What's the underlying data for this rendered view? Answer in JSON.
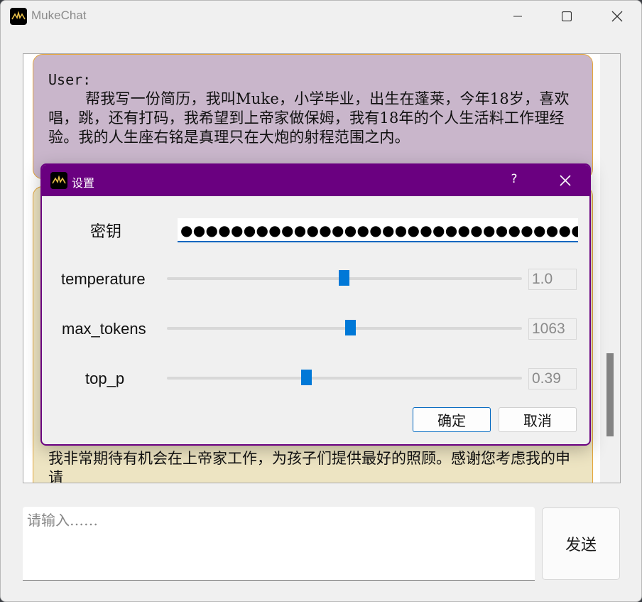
{
  "window": {
    "title": "MukeChat",
    "accent": "#6a0080"
  },
  "chat": {
    "user": {
      "speaker": "User:",
      "text": "帮我写一份简历，我叫Muke，小学毕业，出生在蓬莱，今年18岁，喜欢唱，跳，还有打码，我希望到上帝家做保姆，我有18年的个人生活料工作理经验。我的人生座右铭是真理只在大炮的射程范围之内。"
    },
    "assistant": {
      "visible_text": "我非常期待有机会在上帝家工作，为孩子们提供最好的照顾。感谢您考虑我的申请"
    }
  },
  "input": {
    "placeholder": "请输入……",
    "send_label": "发送"
  },
  "settings_dialog": {
    "title": "设置",
    "help": "?",
    "fields": {
      "api_key": {
        "label": "密钥",
        "masked_value": "●●●●●●●●●●●●●●●●●●●●●●●●●●●●●●●●●●●●●●●●●●●●●●●●●●●●●●●●●●"
      },
      "temperature": {
        "label": "temperature",
        "value": "1.0"
      },
      "max_tokens": {
        "label": "max_tokens",
        "value": "1063"
      },
      "top_p": {
        "label": "top_p",
        "value": "0.39"
      }
    },
    "ok_label": "确定",
    "cancel_label": "取消"
  }
}
